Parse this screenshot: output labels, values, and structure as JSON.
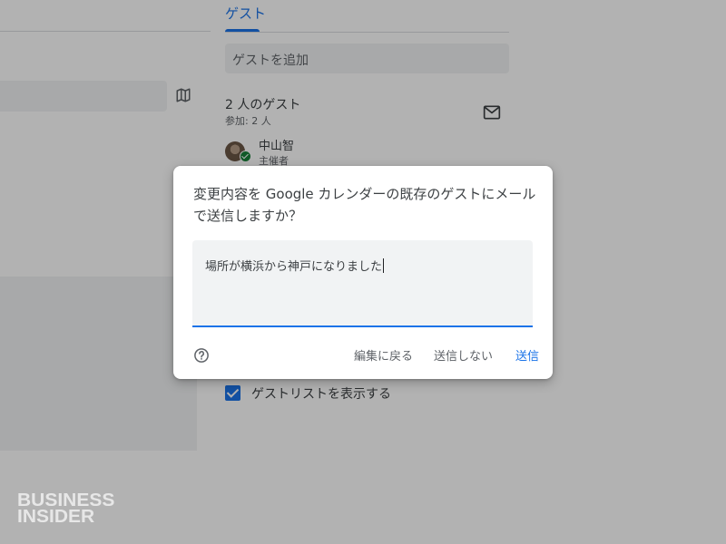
{
  "guests_panel": {
    "tab_label": "ゲスト",
    "add_guests_placeholder": "ゲストを追加",
    "guest_count": "2 人のゲスト",
    "attending": "参加: 2 人",
    "guests": [
      {
        "name": "中山智",
        "role": "主催者"
      }
    ],
    "show_guest_list_label": "ゲストリストを表示する",
    "show_guest_list_checked": true
  },
  "dialog": {
    "title": "変更内容を Google カレンダーの既存のゲストにメールで送信しますか？",
    "message_value": "場所が横浜から神戸になりました",
    "buttons": {
      "back_to_edit": "編集に戻る",
      "dont_send": "送信しない",
      "send": "送信"
    }
  },
  "watermark": {
    "line1": "BUSINESS",
    "line2": "INSIDER"
  },
  "icons": {
    "map": "map-icon",
    "mail": "mail-icon",
    "help": "help-icon"
  },
  "colors": {
    "accent": "#1a73e8",
    "field_bg": "#f1f3f4",
    "text": "#3c4043",
    "secondary_text": "#5f6368",
    "check_badge": "#188038"
  }
}
